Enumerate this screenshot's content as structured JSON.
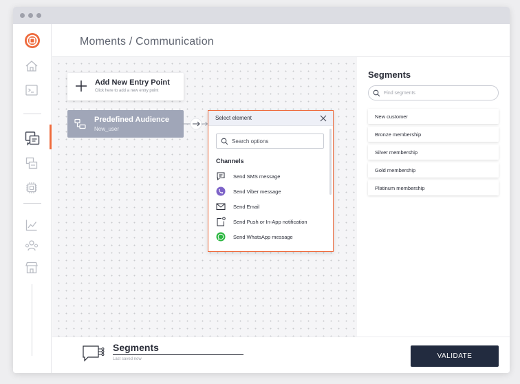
{
  "header": {
    "breadcrumb": "Moments / Communication"
  },
  "canvas": {
    "entry_point": {
      "title": "Add New Entry Point",
      "subtitle": "Click here to add a new entry point"
    },
    "audience": {
      "title": "Predefined Audience",
      "subtitle": "New_user"
    }
  },
  "popup": {
    "title": "Select element",
    "search_placeholder": "Search options",
    "section_label": "Channels",
    "items": [
      {
        "label": "Send SMS message",
        "icon": "sms-icon"
      },
      {
        "label": "Send Viber message",
        "icon": "viber-icon"
      },
      {
        "label": "Send Email",
        "icon": "email-icon"
      },
      {
        "label": "Send Push or In-App notification",
        "icon": "push-notification-icon"
      },
      {
        "label": "Send WhatsApp message",
        "icon": "whatsapp-icon"
      }
    ]
  },
  "segments_panel": {
    "title": "Segments",
    "search_placeholder": "Find segments",
    "items": [
      "New customer",
      "Bronze membership",
      "Silver membership",
      "Gold membership",
      "Platinum membership"
    ]
  },
  "bottom_bar": {
    "title": "Segments",
    "subtitle": "Last saved now",
    "validate_label": "VALIDATE"
  },
  "colors": {
    "accent": "#ee6a3c",
    "primary_dark": "#222b3f",
    "audience_node": "#a0a6b8"
  }
}
